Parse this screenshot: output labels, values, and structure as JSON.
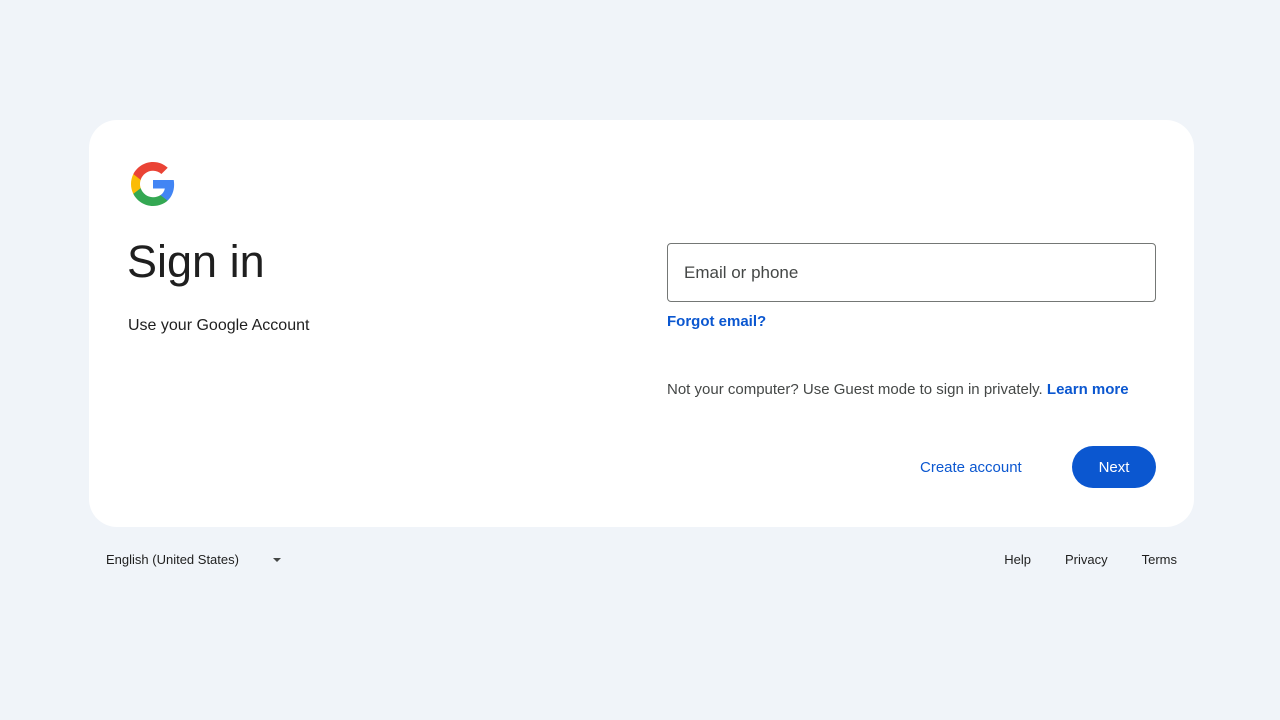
{
  "signin": {
    "title": "Sign in",
    "subtitle": "Use your Google Account",
    "email_placeholder": "Email or phone",
    "email_value": "",
    "forgot_email": "Forgot email?",
    "guest_text": "Not your computer? Use Guest mode to sign in privately.",
    "learn_more": "Learn more",
    "create_account": "Create account",
    "next": "Next"
  },
  "footer": {
    "language": "English (United States)",
    "links": [
      "Help",
      "Privacy",
      "Terms"
    ]
  },
  "icons": {
    "logo": "google-logo-icon",
    "language_caret": "caret-down-icon"
  },
  "colors": {
    "background": "#f0f4f9",
    "card": "#ffffff",
    "primary": "#0b57d0",
    "text": "#1f1f1f",
    "logo_blue": "#4285F4",
    "logo_red": "#EA4335",
    "logo_yellow": "#FBBC05",
    "logo_green": "#34A853"
  }
}
